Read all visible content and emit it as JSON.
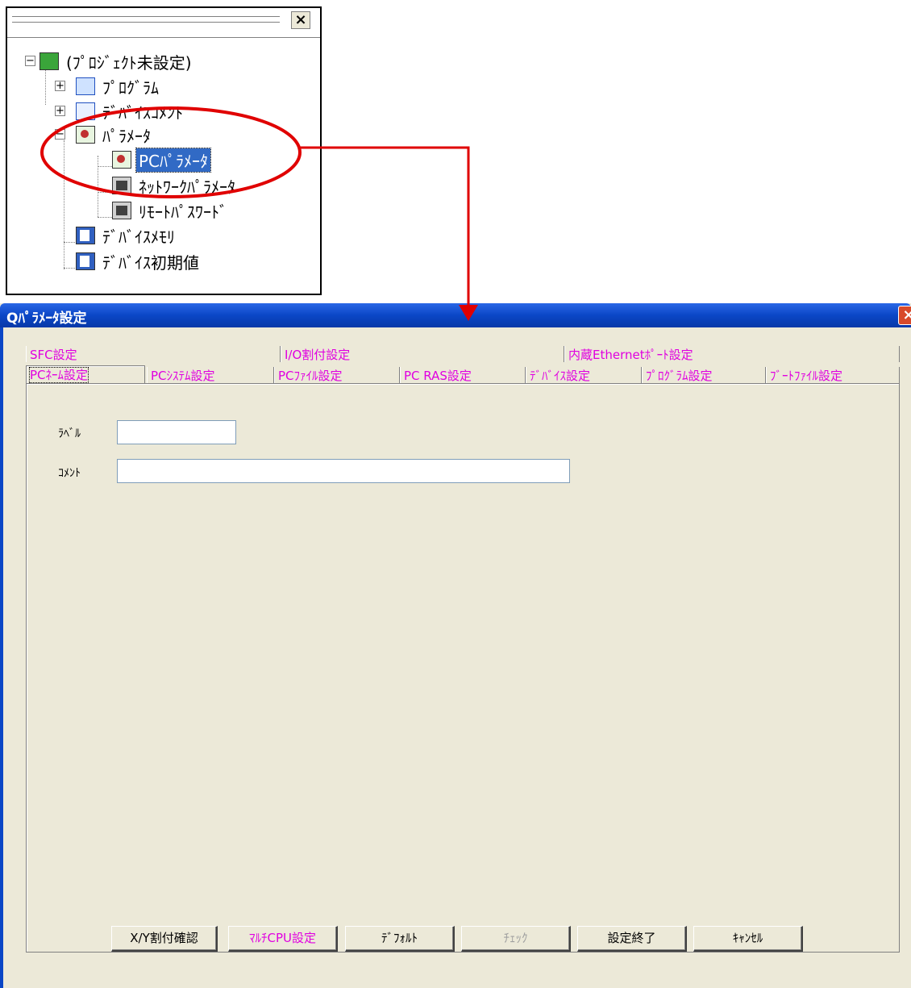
{
  "tree": {
    "close_label": "×",
    "nodes": [
      {
        "label": "(ﾌﾟﾛｼﾞｪｸﾄ未設定)",
        "icon": "project-icon"
      },
      {
        "label": "ﾌﾟﾛｸﾞﾗﾑ",
        "icon": "program-icon"
      },
      {
        "label": "ﾃﾞﾊﾞｲｽｺﾒﾝﾄ",
        "icon": "device-comment-icon"
      },
      {
        "label": "ﾊﾟﾗﾒｰﾀ",
        "icon": "parameter-icon"
      },
      {
        "label": "PCﾊﾟﾗﾒｰﾀ",
        "icon": "pc-parameter-icon",
        "selected": true
      },
      {
        "label": "ﾈｯﾄﾜｰｸﾊﾟﾗﾒｰﾀ",
        "icon": "network-parameter-icon"
      },
      {
        "label": "ﾘﾓｰﾄﾊﾟｽﾜｰﾄﾞ",
        "icon": "remote-password-icon"
      },
      {
        "label": "ﾃﾞﾊﾞｲｽﾒﾓﾘ",
        "icon": "device-memory-icon"
      },
      {
        "label": "ﾃﾞﾊﾞｲｽ初期値",
        "icon": "device-initial-value-icon"
      }
    ]
  },
  "annotation": {
    "color": "#e00000"
  },
  "dialog": {
    "title": "Qﾊﾟﾗﾒｰﾀ設定",
    "close_label": "×",
    "tabs_row1": [
      "SFC設定",
      "I/O割付設定",
      "内蔵Ethernetﾎﾟｰﾄ設定"
    ],
    "tabs_row2": [
      "PCﾈｰﾑ設定",
      "PCｼｽﾃﾑ設定",
      "PCﾌｧｲﾙ設定",
      "PC RAS設定",
      "ﾃﾞﾊﾞｲｽ設定",
      "ﾌﾟﾛｸﾞﾗﾑ設定",
      "ﾌﾞｰﾄﾌｧｲﾙ設定"
    ],
    "active_tab": "PCﾈｰﾑ設定",
    "fields": {
      "label_caption": "ﾗﾍﾞﾙ",
      "label_value": "",
      "comment_caption": "ｺﾒﾝﾄ",
      "comment_value": ""
    },
    "buttons": {
      "xy_check": "X/Y割付確認",
      "multi_cpu": "ﾏﾙﾁCPU設定",
      "default": "ﾃﾞﾌｫﾙﾄ",
      "check": "ﾁｪｯｸ",
      "finish": "設定終了",
      "cancel": "ｷｬﾝｾﾙ"
    },
    "colors": {
      "tab_text": "#e000e0",
      "title_bar": "#0a46c6"
    }
  }
}
